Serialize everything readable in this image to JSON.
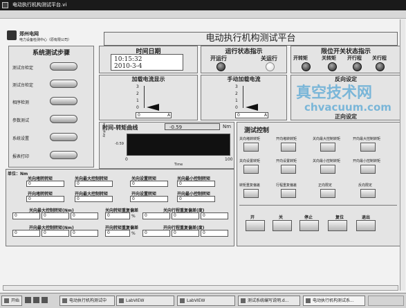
{
  "window": {
    "title": "电动执行机构测试平台.vi"
  },
  "logo": {
    "line1": "郑州电网",
    "line2": "电力设备检测中心（原有限公司）"
  },
  "app_title": "电动执行机构测试平台",
  "steps": {
    "title": "系统测试步骤",
    "items": [
      {
        "label": "测试台检定"
      },
      {
        "label": "测试台检定"
      },
      {
        "label": "相序检测"
      },
      {
        "label": "参数测试"
      },
      {
        "label": "系统设置"
      },
      {
        "label": "报表打印"
      }
    ]
  },
  "datetime": {
    "title": "时间日期",
    "time": "10:15:32",
    "date": "2010-3-4"
  },
  "run_status": {
    "title": "运行状态指示",
    "forward": "开运行",
    "reverse": "关运行"
  },
  "limit_status": {
    "title": "限位开关状态指示",
    "labels": [
      "开转矩",
      "关转矩",
      "开行程",
      "关行程"
    ]
  },
  "load_current": {
    "title": "加载电流显示",
    "ticks": [
      "3",
      "2",
      "1",
      "0"
    ],
    "axis": "0",
    "unit": "A",
    "value": 0
  },
  "manual_current": {
    "title": "手动加载电流",
    "ticks": [
      "3",
      "2",
      "1",
      "0"
    ],
    "axis": "0",
    "unit": "A",
    "value": 0
  },
  "right_panel": {
    "label1": "反向设定",
    "label2": "正向设定"
  },
  "curve": {
    "title": "时间-转矩曲线",
    "value": "-0.59",
    "unit": "Nm",
    "ylabel": "Amplitude",
    "marker": "-0.59",
    "x0": "0",
    "x1": "100",
    "xlabel": "Time"
  },
  "params": {
    "unit_label": "单位：Nm",
    "row1": [
      "关向堵转转矩",
      "关向最大控制转矩",
      "关向设置转矩",
      "关向最小控制转矩"
    ],
    "row2": [
      "开向堵转转矩",
      "开向最大控制转矩",
      "开向设置转矩",
      "开向最小控制转矩"
    ],
    "row3": [
      "关向最大控制转矩(Nm)",
      "关向转矩重复偏差",
      "关向行程重复偏差(度)"
    ],
    "row4": [
      "开向最大控制转矩(Nm)",
      "开向转矩重复偏差",
      "开向行程重复偏差(度)"
    ],
    "vals": [
      "0",
      "0",
      "0",
      "0"
    ],
    "pct": "%"
  },
  "control": {
    "title": "测试控制",
    "row1": [
      "关向堵转转矩",
      "开向堵转转矩",
      "关向最大控制转矩",
      "开向最大控制转矩"
    ],
    "row2": [
      "关向设置转矩",
      "开向设置转矩",
      "关向最小控制转矩",
      "开向最小控制转矩"
    ],
    "row3": [
      "转矩重复偏差",
      "行程重复偏差",
      "正向限定",
      "反向限定"
    ],
    "bottom": [
      "开",
      "关",
      "停止",
      "复位",
      "退出"
    ]
  },
  "taskbar": {
    "start": "开始",
    "items": [
      "电动执行机构测试中",
      "LabVIEW",
      "LabVIEW",
      "测试系统编写说明.d...",
      "电动执行机构测试系..."
    ]
  },
  "watermark": {
    "cn": "真空技术网",
    "url": "chvacuum.com"
  }
}
